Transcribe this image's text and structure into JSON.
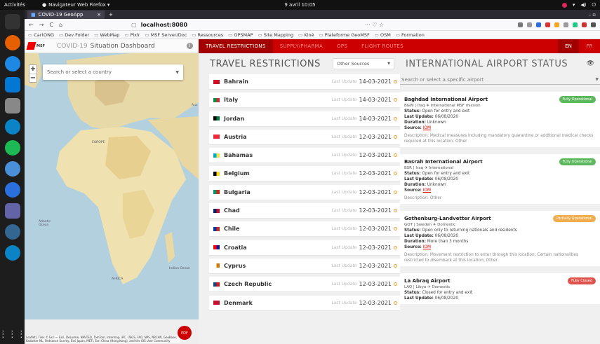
{
  "os": {
    "activities": "Activités",
    "browser_app": "Navigateur Web Firefox ▾",
    "clock": "9 avril 10:05"
  },
  "browser": {
    "tab_title": "COVID-19 GeoApp",
    "tab_close": "×",
    "new_tab": "+",
    "window_controls": "– ▫",
    "url": "localhost:8080",
    "url_more": "··· ♡ ☆",
    "nav": {
      "back": "←",
      "forward": "→",
      "reload": "C",
      "home": "⌂"
    },
    "bookmarks": [
      "CartONG",
      "Dev Folder",
      "WebMap",
      "Pixlr",
      "MSF Server/Doc",
      "Ressources",
      "OPSMAP",
      "Site Mapping",
      "Kiné",
      "Plateforme GeoMSF",
      "OSM",
      "Formation"
    ]
  },
  "app": {
    "logo_text": "MSF",
    "title_gray": "COVID-19",
    "title_main": "Situation Dashboard",
    "info": "i",
    "nav": [
      {
        "label": "TRAVEL RESTRICTIONS",
        "active": true
      },
      {
        "label": "SUPPLY/PHARMA",
        "active": false
      },
      {
        "label": "OPS",
        "active": false
      },
      {
        "label": "FLIGHT ROUTES",
        "active": false
      }
    ],
    "langs": [
      {
        "label": "EN",
        "active": true
      },
      {
        "label": "FR",
        "active": false
      }
    ]
  },
  "map": {
    "search_placeholder": "Search or select a country",
    "zoom_in": "+",
    "zoom_out": "−",
    "pdf_label": "PDF",
    "labels": {
      "europe": "EUROPE",
      "africa": "AFRICA",
      "atlantic": "Atlantic Ocean",
      "indian": "Indian Ocean",
      "arabian": "Ara"
    },
    "attribution": "Leaflet | Tiles © Esri — Esri, DeLorme, NAVTEQ, TomTom, Intermap, iPC, USGS, FAO, NPS, NRCAN, GeoBase, Kadaster NL, Ordnance Survey, Esri Japan, METI, Esri China (Hong Kong), and the GIS User Community"
  },
  "travel": {
    "title": "TRAVEL RESTRICTIONS",
    "source_select": "Other Sources",
    "last_update_label": "Last Update",
    "countries": [
      {
        "name": "Bahrain",
        "date": "14-03-2021",
        "flag": [
          "#ce1126",
          "#ce1126"
        ]
      },
      {
        "name": "Italy",
        "date": "14-03-2021",
        "flag": [
          "#009246",
          "#ce2b37"
        ]
      },
      {
        "name": "Jordan",
        "date": "14-03-2021",
        "flag": [
          "#000000",
          "#007a3d"
        ]
      },
      {
        "name": "Austria",
        "date": "12-03-2021",
        "flag": [
          "#ed2939",
          "#ed2939"
        ]
      },
      {
        "name": "Bahamas",
        "date": "12-03-2021",
        "flag": [
          "#00abc9",
          "#fae042"
        ]
      },
      {
        "name": "Belgium",
        "date": "12-03-2021",
        "flag": [
          "#000000",
          "#fdda24"
        ]
      },
      {
        "name": "Bulgaria",
        "date": "12-03-2021",
        "flag": [
          "#00966e",
          "#d62612"
        ]
      },
      {
        "name": "Chad",
        "date": "12-03-2021",
        "flag": [
          "#002664",
          "#c60c30"
        ]
      },
      {
        "name": "Chile",
        "date": "12-03-2021",
        "flag": [
          "#0039a6",
          "#d52b1e"
        ]
      },
      {
        "name": "Croatia",
        "date": "12-03-2021",
        "flag": [
          "#ff0000",
          "#171796"
        ]
      },
      {
        "name": "Cyprus",
        "date": "12-03-2021",
        "flag": [
          "#ffffff",
          "#d57800"
        ]
      },
      {
        "name": "Czech Republic",
        "date": "12-03-2021",
        "flag": [
          "#11457e",
          "#d7141a"
        ]
      },
      {
        "name": "Denmark",
        "date": "12-03-2021",
        "flag": [
          "#c8102e",
          "#c8102e"
        ]
      }
    ]
  },
  "airports": {
    "title": "INTERNATIONAL AIRPORT STATUS",
    "search_placeholder": "Search or select a specific airport",
    "labels": {
      "status": "Status:",
      "last_update": "Last Update:",
      "duration": "Duration:",
      "source": "Source:",
      "description": "Description:"
    },
    "items": [
      {
        "name": "Baghdad International Airport",
        "code_line": "BGW | Iraq",
        "type": "International MSF mission",
        "badge": "Fully Operational",
        "badge_color": "#5cb85c",
        "status": "Open for entry and exit",
        "last_update": "06/08/2020",
        "duration": "Unknown",
        "source": "IOM",
        "description": "Medical measures including mandatory quarantine or additional medical checks required at this location; Other"
      },
      {
        "name": "Basrah International Airport",
        "code_line": "BSR | Iraq",
        "type": "International",
        "badge": "Fully Operational",
        "badge_color": "#5cb85c",
        "status": "Open for entry and exit",
        "last_update": "06/08/2020",
        "duration": "Unknown",
        "source": "IOM",
        "description": "Other"
      },
      {
        "name": "Gothenburg-Landvetter Airport",
        "code_line": "GOT | Sweden",
        "type": "Domestic",
        "badge": "Partially Operational",
        "badge_color": "#f0ad4e",
        "status": "Open only to returning nationals and residents",
        "last_update": "06/08/2020",
        "duration": "More than 3 months",
        "source": "IOM",
        "description": "Movement restriction to enter through this location; Certain nationalities restricted to disembark at this location; Other"
      },
      {
        "name": "La Abraq Airport",
        "code_line": "LAQ | Libya",
        "type": "Domestic",
        "badge": "Fully Closed",
        "badge_color": "#e0534a",
        "status": "Closed for entry and exit",
        "last_update": "06/08/2020",
        "duration": "",
        "source": "",
        "description": ""
      }
    ]
  }
}
